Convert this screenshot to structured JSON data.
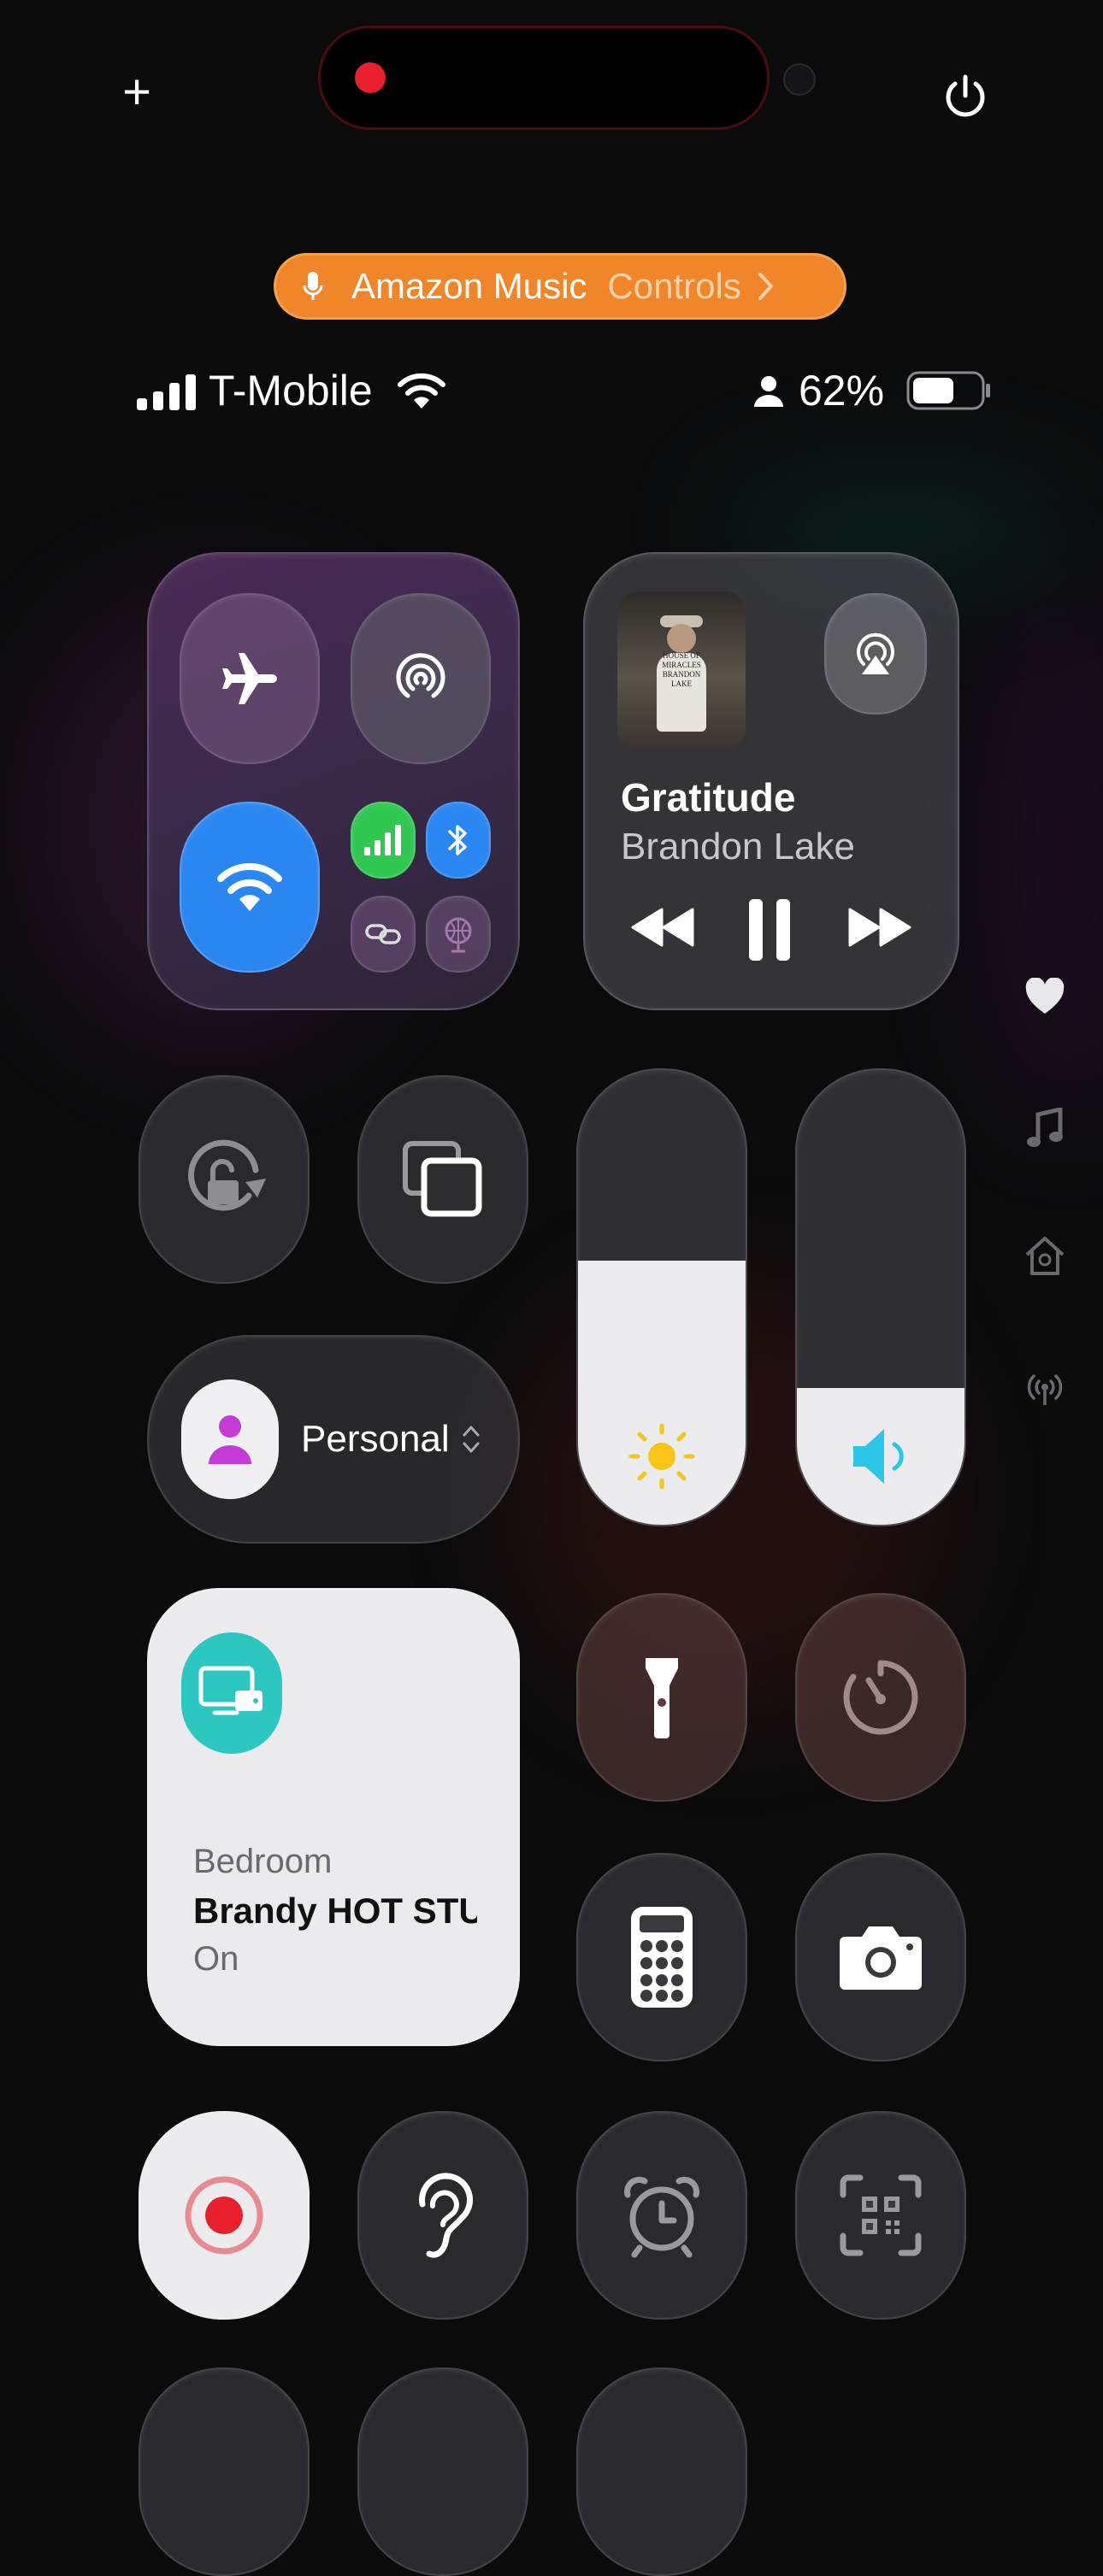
{
  "top_bar": {
    "add_glyph": "+"
  },
  "banner": {
    "app_name": "Amazon Music",
    "action": "Controls"
  },
  "status": {
    "carrier": "T-Mobile",
    "battery": "62%"
  },
  "now_playing": {
    "title": "Gratitude",
    "artist": "Brandon Lake",
    "artwork_caption": "HOUSE OF MIRACLES BRANDON LAKE"
  },
  "focus": {
    "label": "Personal"
  },
  "home_accessory": {
    "room": "Bedroom",
    "name": "Brandy HOT STUFF",
    "state": "On"
  },
  "sliders": {
    "brightness": 0.58,
    "volume": 0.3
  },
  "colors": {
    "accent_blue": "#2a86f0",
    "cellular_green": "#31c852",
    "banner_orange": "#f0852a",
    "focus_purple": "#c43bd6",
    "tv_teal": "#2cc7c0",
    "record_red": "#e8202d"
  }
}
